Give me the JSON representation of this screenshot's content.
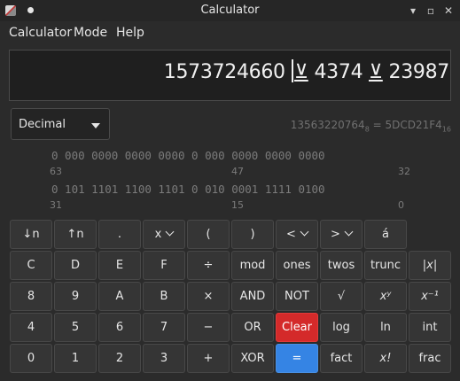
{
  "window": {
    "title": "Calculator",
    "icon": "calculator-app-icon",
    "controls": [
      "minimize",
      "maximize",
      "close"
    ]
  },
  "menubar": {
    "items": [
      "Calculator",
      "Mode",
      "Help"
    ]
  },
  "display": {
    "expr_a": "1573724660",
    "op1": "⊻",
    "expr_b": "4374",
    "op2": "⊻",
    "expr_c": "23987"
  },
  "base_select": {
    "value": "Decimal"
  },
  "conversion": {
    "oct_value": "13563220764",
    "oct_base": "8",
    "equals": "=",
    "hex_value": "5DCD21F4",
    "hex_base": "16"
  },
  "bits": {
    "row1": "0 000 0000 0000 0000 0 000 0000 0000 0000",
    "row1_labels": {
      "left": "63",
      "mid": "47",
      "right": "32"
    },
    "row2": "0 101 1101 1100 1101 0 010 0001 1111 0100",
    "row2_labels": {
      "left": "31",
      "mid": "15",
      "right": "0"
    }
  },
  "keypad": {
    "row0": [
      "↓n",
      "↑n",
      ".",
      "x",
      "(",
      ")",
      "<",
      ">",
      "á"
    ],
    "row1": [
      "C",
      "D",
      "E",
      "F",
      "÷",
      "mod",
      "ones",
      "twos",
      "trunc",
      "|x|"
    ],
    "row2": [
      "8",
      "9",
      "A",
      "B",
      "×",
      "AND",
      "NOT",
      "√",
      "xʸ",
      "x⁻¹"
    ],
    "row3": [
      "4",
      "5",
      "6",
      "7",
      "−",
      "OR",
      "Clear",
      "log",
      "ln",
      "int"
    ],
    "row4": [
      "0",
      "1",
      "2",
      "3",
      "+",
      "XOR",
      "=",
      "fact",
      "x!",
      "frac"
    ]
  },
  "colors": {
    "clear_button": "#d42a2a",
    "equals_button": "#3584e4",
    "background": "#2b2b2b"
  }
}
